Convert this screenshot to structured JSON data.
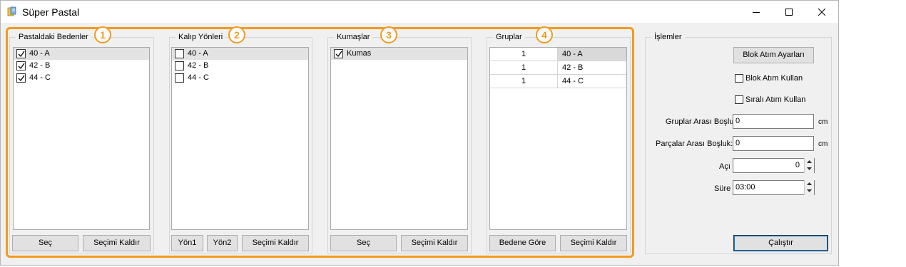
{
  "window": {
    "title": "Süper Pastal",
    "controls": [
      "minimize-icon",
      "maximize-icon",
      "close-icon"
    ]
  },
  "accent_color": "#f39a1f",
  "badges": [
    "1",
    "2",
    "3",
    "4"
  ],
  "panels": {
    "bedenler": {
      "legend": "Pastaldaki Bedenler",
      "items": [
        {
          "label": "40 - A",
          "checked": true
        },
        {
          "label": "42 - B",
          "checked": true
        },
        {
          "label": "44 - C",
          "checked": true
        }
      ],
      "buttons": [
        "Seç",
        "Seçimi Kaldır"
      ]
    },
    "yonler": {
      "legend": "Kalıp Yönleri",
      "items": [
        {
          "label": "40 - A",
          "checked": false
        },
        {
          "label": "42 - B",
          "checked": false
        },
        {
          "label": "44 - C",
          "checked": false
        }
      ],
      "buttons": [
        "Yön1",
        "Yön2",
        "Seçimi Kaldır"
      ]
    },
    "kumaslar": {
      "legend": "Kumaşlar",
      "items": [
        {
          "label": "Kumas",
          "checked": true
        }
      ],
      "buttons": [
        "Seç",
        "Seçimi Kaldır"
      ]
    },
    "gruplar": {
      "legend": "Gruplar",
      "rows": [
        {
          "group": "1",
          "size": "40 - A"
        },
        {
          "group": "1",
          "size": "42 - B"
        },
        {
          "group": "1",
          "size": "44 - C"
        }
      ],
      "buttons": [
        "Bedene Göre",
        "Seçimi Kaldır"
      ]
    }
  },
  "islemler": {
    "legend": "İşlemler",
    "blok_button": "Blok Atım Ayarları",
    "blok_checkbox": "Blok Atım Kullan",
    "sirali_checkbox": "Sıralı Atım Kullan",
    "gruplar_label": "Gruplar Arası Boşluk:",
    "gruplar_value": "0",
    "gruplar_unit": "cm",
    "parcalar_label": "Parçalar Arası Boşluk:",
    "parcalar_value": "0",
    "parcalar_unit": "cm",
    "aci_label": "Açı",
    "aci_value": "0",
    "sure_label": "Süre",
    "sure_value": "03:00",
    "run_button": "Çalıştır"
  }
}
